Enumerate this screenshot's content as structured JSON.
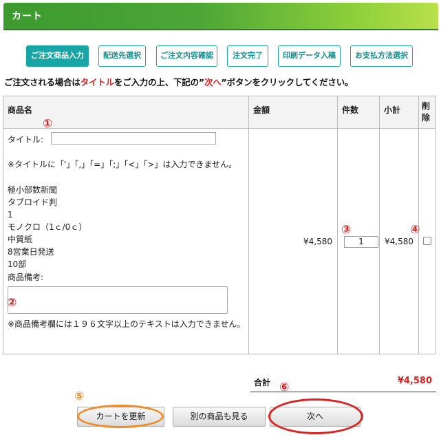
{
  "header": {
    "title": "カート"
  },
  "steps": [
    {
      "label": "ご注文商品入力",
      "active": true
    },
    {
      "label": "配送先選択",
      "active": false
    },
    {
      "label": "ご注文内容確認",
      "active": false
    },
    {
      "label": "注文完了",
      "active": false
    },
    {
      "label": "印刷データ入稿",
      "active": false
    },
    {
      "label": "お支払方法選択",
      "active": false
    }
  ],
  "instruction": {
    "part1": "ご注文される場合は",
    "part2": "タイトル",
    "part3": "をご入力の上、下記の”",
    "part4": "次へ",
    "part5": "”ボタンをクリックしてください。"
  },
  "table": {
    "headers": {
      "name": "商品名",
      "price": "金額",
      "qty": "件数",
      "subtotal": "小計",
      "delete": "削除"
    }
  },
  "item": {
    "title_label": "タイトル:",
    "title_value": "",
    "title_note": "※タイトルに「'」「,」「=」「;」「<」「>」は入力できません。",
    "details": [
      "極小部数新聞",
      "タブロイド判",
      "1",
      "モノクロ（1ｃ/0ｃ）",
      "中質紙",
      "8営業日発送",
      "10部"
    ],
    "memo_label": "商品備考:",
    "memo_value": "",
    "memo_note": "※商品備考欄には１９６文字以上のテキストは入力できません。",
    "price": "¥4,580",
    "quantity": "1",
    "subtotal": "¥4,580",
    "delete_checked": false
  },
  "total": {
    "label": "合計",
    "value": "¥4,580"
  },
  "buttons": {
    "update": "カートを更新",
    "browse": "別の商品も見る",
    "next": "次へ"
  },
  "markers": {
    "m1": "①",
    "m2": "②",
    "m3": "③",
    "m4": "④",
    "m5": "⑤",
    "m6": "⑥"
  },
  "colors": {
    "header_green": "#4da637",
    "step_teal": "#17a5a5",
    "accent_red": "#e22222",
    "marker_orange": "#f08a24"
  }
}
